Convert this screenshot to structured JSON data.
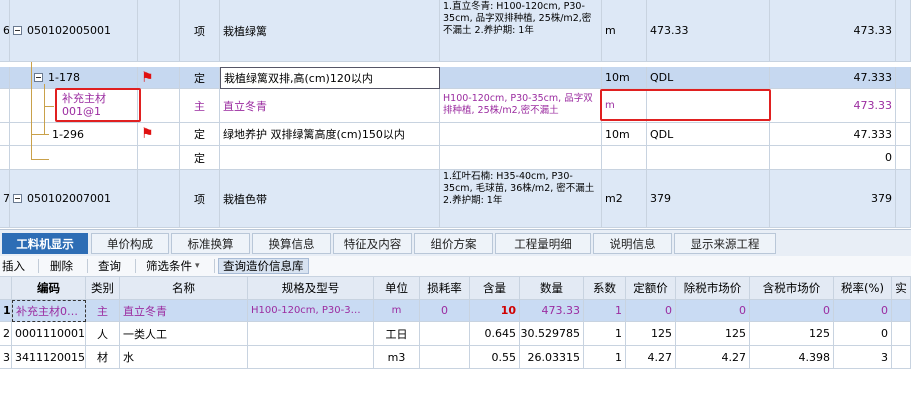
{
  "upper": {
    "rows": [
      {
        "rownum": "6",
        "code": "050102005001",
        "type": "项",
        "name": "栽植绿篱",
        "spec": "1.直立冬青: H100-120cm, P30-35cm, 品字双排种植, 25株/m2,密不漏土 2.养护期: 1年",
        "unit": "m",
        "qty_expr": "473.33",
        "qty": "473.33"
      },
      {
        "rownum": "",
        "code": "1-178",
        "type": "定",
        "name": "栽植绿篱双排,高(cm)120以内",
        "spec": "",
        "unit": "10m",
        "qty_expr": "QDL",
        "qty": "47.333"
      },
      {
        "rownum": "",
        "code": "补充主材\n001@1",
        "type": "主",
        "name": "直立冬青",
        "spec": "H100-120cm, P30-35cm, 品字双排种植, 25株/m2,密不漏土",
        "unit": "m",
        "qty_expr": "",
        "qty": "473.33"
      },
      {
        "rownum": "",
        "code": "1-296",
        "type": "定",
        "name": "绿地养护 双排绿篱高度(cm)150以内",
        "spec": "",
        "unit": "10m",
        "qty_expr": "QDL",
        "qty": "47.333"
      },
      {
        "rownum": "",
        "code": "",
        "type": "定",
        "name": "",
        "spec": "",
        "unit": "",
        "qty_expr": "",
        "qty": "0"
      },
      {
        "rownum": "7",
        "code": "050102007001",
        "type": "项",
        "name": "栽植色带",
        "spec": "1.红叶石楠: H35-40cm, P30-35cm, 毛球苗, 36株/m2, 密不漏土 2.养护期: 1年",
        "unit": "m2",
        "qty_expr": "379",
        "qty": "379"
      }
    ]
  },
  "tabs": [
    "工料机显示",
    "单价构成",
    "标准换算",
    "换算信息",
    "特征及内容",
    "组价方案",
    "工程量明细",
    "说明信息",
    "显示来源工程"
  ],
  "toolbar": {
    "insert": "插入",
    "delete": "删除",
    "query": "查询",
    "filter": "筛选条件",
    "filter_arrow": "▾",
    "query_price": "查询造价信息库"
  },
  "lower": {
    "headers": [
      "编码",
      "类别",
      "名称",
      "规格及型号",
      "单位",
      "损耗率",
      "含量",
      "数量",
      "系数",
      "定额价",
      "除税市场价",
      "含税市场价",
      "税率(%)",
      "实"
    ],
    "rows": [
      {
        "idx": "1",
        "code": "补充主材0…",
        "cat": "主",
        "name": "直立冬青",
        "spec": "H100-120cm, P30-3…",
        "unit": "m",
        "loss": "0",
        "content": "10",
        "qty": "473.33",
        "coef": "1",
        "quota": "0",
        "mkt_ex": "0",
        "mkt_in": "0",
        "tax": "0"
      },
      {
        "idx": "2",
        "code": "0001110001",
        "cat": "人",
        "name": "一类人工",
        "spec": "",
        "unit": "工日",
        "loss": "",
        "content": "0.645",
        "qty": "30.529785",
        "coef": "1",
        "quota": "125",
        "mkt_ex": "125",
        "mkt_in": "125",
        "tax": "0"
      },
      {
        "idx": "3",
        "code": "3411120015",
        "cat": "材",
        "name": "水",
        "spec": "",
        "unit": "m3",
        "loss": "",
        "content": "0.55",
        "qty": "26.03315",
        "coef": "1",
        "quota": "4.27",
        "mkt_ex": "4.27",
        "mkt_in": "4.398",
        "tax": "3"
      }
    ]
  },
  "colors": {
    "accent": "#2d6db5",
    "highlight_box": "#e02020",
    "subitem_text": "#9b2ca0",
    "flag": "#e01010"
  },
  "icons": {
    "flag": "red-flag-icon",
    "tree": "collapse-box-icon"
  }
}
